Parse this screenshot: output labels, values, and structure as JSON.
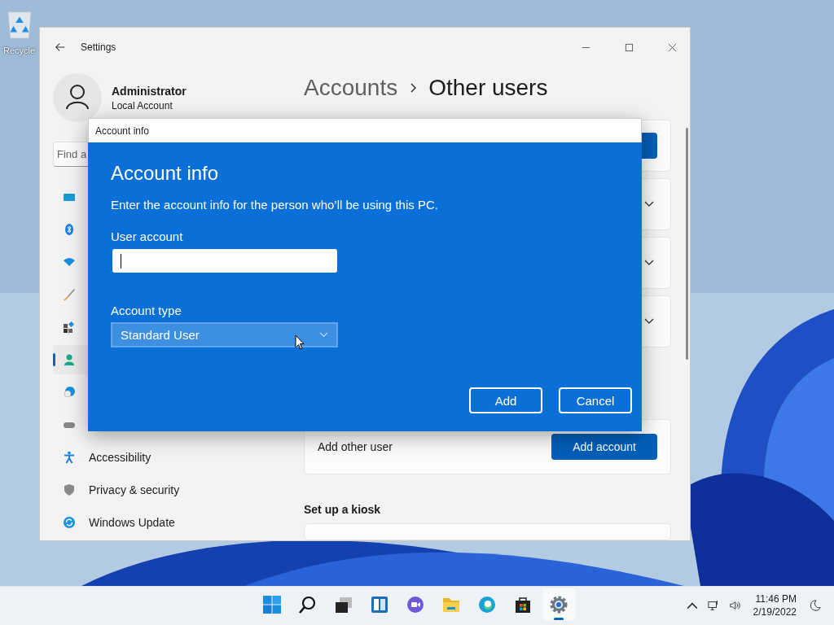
{
  "desktop": {
    "icons": [
      {
        "kind": "recycle-bin",
        "label": "Recycle"
      }
    ]
  },
  "settings_window": {
    "title": "Settings",
    "profile": {
      "name": "Administrator",
      "account_type": "Local Account"
    },
    "search": {
      "placeholder": "Find a"
    },
    "sidebar": {
      "items": [
        {
          "kind": "system",
          "selected": false
        },
        {
          "kind": "bluetooth",
          "selected": false
        },
        {
          "kind": "network",
          "selected": false
        },
        {
          "kind": "personalization",
          "selected": false
        },
        {
          "kind": "apps",
          "selected": false
        },
        {
          "kind": "accounts",
          "selected": true
        },
        {
          "kind": "time",
          "selected": false
        },
        {
          "kind": "gaming",
          "selected": false
        },
        {
          "kind": "accessibility",
          "label": "Accessibility",
          "selected": false
        },
        {
          "kind": "privacy",
          "label": "Privacy & security",
          "selected": false
        },
        {
          "kind": "update",
          "label": "Windows Update",
          "selected": false
        }
      ]
    },
    "breadcrumb": {
      "parent": "Accounts",
      "current": "Other users"
    },
    "cards": [
      {
        "kind": "button"
      },
      {
        "kind": "expander"
      },
      {
        "kind": "expander"
      },
      {
        "kind": "expander"
      },
      {
        "kind": "action",
        "label": "Add other user",
        "button": "Add account"
      }
    ],
    "kiosk": {
      "heading": "Set up a kiosk"
    }
  },
  "dialog": {
    "title": "Account info",
    "heading": "Account info",
    "description": "Enter the account info for the person who’ll be using this PC.",
    "user_account": {
      "label": "User account"
    },
    "account_type": {
      "label": "Account type",
      "value": "Standard User"
    },
    "buttons": [
      "Add",
      "Cancel"
    ]
  },
  "taskbar": {
    "apps": [
      {
        "kind": "start",
        "selected": false
      },
      {
        "kind": "search",
        "selected": false
      },
      {
        "kind": "task-view",
        "selected": false
      },
      {
        "kind": "widgets",
        "selected": false
      },
      {
        "kind": "chat",
        "selected": false
      },
      {
        "kind": "explorer",
        "selected": false
      },
      {
        "kind": "edge",
        "selected": false
      },
      {
        "kind": "store",
        "selected": false
      },
      {
        "kind": "settings",
        "selected": true
      }
    ],
    "time": "11:46 PM",
    "date": "2/19/2022"
  }
}
